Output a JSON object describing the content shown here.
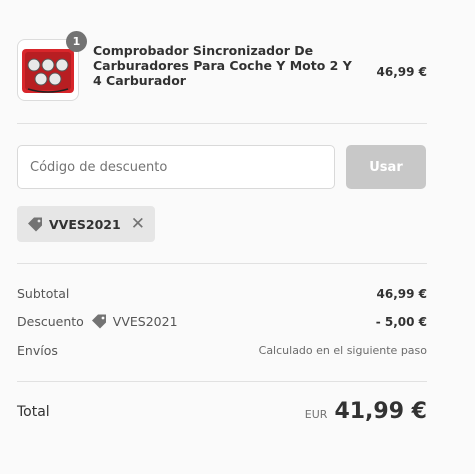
{
  "product": {
    "quantity": "1",
    "name": "Comprobador Sincronizador De Carburadores Para Coche Y Moto 2 Y 4 Carburador",
    "price": "46,99 €",
    "image_icon": "carburetor-tester-kit"
  },
  "discount": {
    "placeholder": "Código de descuento",
    "value": "",
    "button_label": "Usar",
    "applied_code": "VVES2021",
    "remove_icon": "close-icon"
  },
  "summary": {
    "subtotal_label": "Subtotal",
    "subtotal_value": "46,99 €",
    "discount_label": "Descuento",
    "discount_code": "VVES2021",
    "discount_value": "- 5,00 €",
    "shipping_label": "Envíos",
    "shipping_value": "Calculado en el siguiente paso",
    "total_label": "Total",
    "currency": "EUR",
    "total_value": "41,99 €"
  },
  "colors": {
    "background": "#fafafa",
    "button_disabled": "#c8c8c8",
    "badge": "#737373",
    "tag_background": "#e6e6e6",
    "product_case": "#d8262b"
  }
}
